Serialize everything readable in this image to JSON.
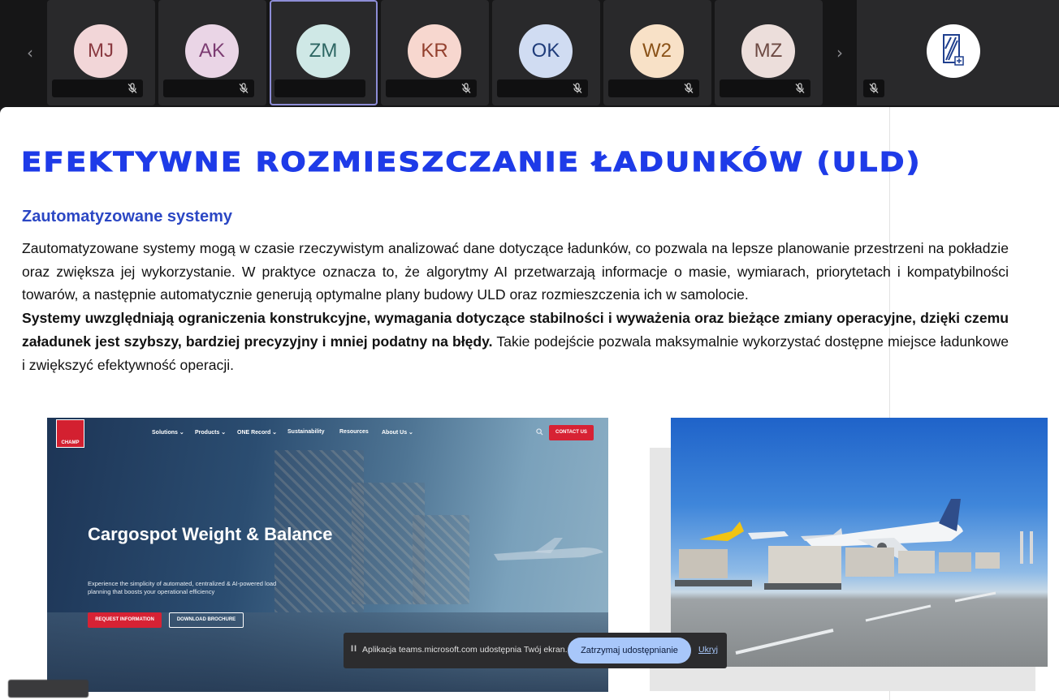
{
  "participants": [
    {
      "initials": "MJ",
      "name": "",
      "bg": "#f2d6d8",
      "fg": "#8a3a41"
    },
    {
      "initials": "AK",
      "name": "",
      "bg": "#ead5e6",
      "fg": "#7c3c72"
    },
    {
      "initials": "ZM",
      "name": "",
      "bg": "#cfe8e6",
      "fg": "#2d6663",
      "active": true
    },
    {
      "initials": "KR",
      "name": "",
      "bg": "#f7d7cf",
      "fg": "#93402e"
    },
    {
      "initials": "OK",
      "name": "",
      "bg": "#d0dcf2",
      "fg": "#1f3c7a"
    },
    {
      "initials": "W2",
      "name": "",
      "bg": "#f8e1c7",
      "fg": "#8a5218"
    },
    {
      "initials": "MZ",
      "name": "",
      "bg": "#ecdedb",
      "fg": "#6d4a43"
    }
  ],
  "slide": {
    "title": "EFEKTYWNE  ROZMIESZCZANIE  ŁADUNKÓW (ULD)",
    "subtitle": "Zautomatyzowane systemy",
    "paragraph_plain_1": "Zautomatyzowane systemy mogą w czasie rzeczywistym analizować dane dotyczące ładunków, co pozwala na lepsze planowanie przestrzeni na pokładzie oraz zwiększa jej wykorzystanie. W praktyce oznacza to, że algorytmy AI przetwarzają informacje o masie, wymiarach, priorytetach i kompatybilności towarów, a następnie automatycznie generują optymalne plany budowy ULD oraz rozmieszczenia ich w samolocie.",
    "paragraph_bold": "Systemy uwzględniają ograniczenia konstrukcyjne, wymagania dotyczące stabilności i wyważenia oraz bieżące zmiany operacyjne, dzięki czemu załadunek jest szybszy, bardziej precyzyjny i mniej podatny na błędy.",
    "paragraph_plain_2": " Takie podejście pozwala maksymalnie wykorzystać dostępne miejsce ładunkowe i zwiększyć efektywność operacji."
  },
  "website": {
    "logo": "CHAMP",
    "nav": [
      "Solutions ⌄",
      "Products ⌄",
      "ONE Record ⌄",
      "Sustainability",
      "Resources",
      "About Us ⌄"
    ],
    "contact": "CONTACT US",
    "headline": "Cargospot Weight & Balance",
    "description": "Experience the simplicity of automated, centralized & AI-powered load planning that boosts your operational efficiency",
    "btn_request": "REQUEST INFORMATION",
    "btn_download": "DOWNLOAD BROCHURE"
  },
  "share_bar": {
    "pause": "II",
    "message": "Aplikacja teams.microsoft.com udostępnia Twój ekran.",
    "stop": "Zatrzymaj udostępnianie",
    "hide": "Ukryj"
  },
  "icons": {
    "prev": "chevron-left-icon",
    "next": "chevron-right-icon",
    "mic": "mic-off-icon",
    "search": "search-icon"
  },
  "colors": {
    "title": "#1e3be8",
    "subtitle": "#2b47c4",
    "share_button": "#a8c7fa",
    "web_red": "#d72234"
  }
}
